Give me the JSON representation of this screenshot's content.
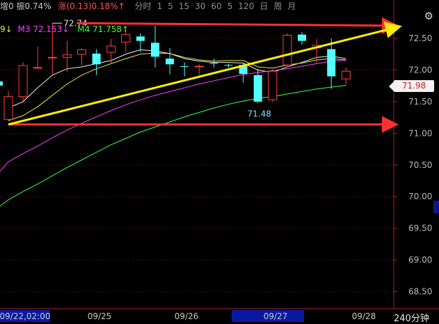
{
  "toolbar": {
    "amp_label": "增0",
    "amp_value": "振0.74%",
    "change_label": "涨",
    "change_value": "(0.13)",
    "change_pct": "0.18%↑",
    "menu_items": [
      "分时",
      "1",
      "5",
      "15",
      "30",
      "60",
      "5",
      "120",
      "日",
      "周",
      "月"
    ]
  },
  "legend": {
    "m2_tail": "9↓",
    "m3": "M3 72.153↓",
    "m4": "M4 71.758↑"
  },
  "current_price": "71.98",
  "timeframe": "240分钟",
  "colors": {
    "up": "#ff4040",
    "down": "#54ffff",
    "m1": "#f0f0f0",
    "m2": "#e8e840",
    "m3": "#ff40ff",
    "m4": "#40ff40",
    "axis": "#b02020",
    "trend_yellow": "#ffee00",
    "trend_red": "#ff3030"
  },
  "chart_data": {
    "type": "candlestick",
    "y_ticks": [
      "72.50",
      "72.00",
      "71.50",
      "71.00",
      "70.50",
      "70.00",
      "69.50",
      "69.00",
      "68.50"
    ],
    "ylim": [
      68.23,
      72.93
    ],
    "x_labels": [
      "09/22,02:00",
      "09/25",
      "09/26",
      "09/27",
      "09/28"
    ],
    "candles": [
      {
        "o": 71.22,
        "c": 71.58,
        "h": 71.67,
        "l": 71.19
      },
      {
        "o": 71.58,
        "c": 72.07,
        "h": 72.12,
        "l": 71.48
      },
      {
        "o": 72.04,
        "c": 72.04,
        "h": 72.37,
        "l": 72.02
      },
      {
        "o": 72.2,
        "c": 72.2,
        "h": 72.74,
        "l": 71.93
      },
      {
        "o": 72.2,
        "c": 72.24,
        "h": 72.46,
        "l": 71.97
      },
      {
        "o": 72.25,
        "c": 72.32,
        "h": 72.34,
        "l": 72.07
      },
      {
        "o": 72.26,
        "c": 72.09,
        "h": 72.33,
        "l": 71.92
      },
      {
        "o": 72.28,
        "c": 72.38,
        "h": 72.49,
        "l": 72.1
      },
      {
        "o": 72.44,
        "c": 72.56,
        "h": 72.65,
        "l": 72.28
      },
      {
        "o": 72.53,
        "c": 72.46,
        "h": 72.58,
        "l": 72.28
      },
      {
        "o": 72.43,
        "c": 72.21,
        "h": 72.7,
        "l": 72.04
      },
      {
        "o": 72.18,
        "c": 72.09,
        "h": 72.35,
        "l": 71.93
      },
      {
        "o": 72.06,
        "c": 72.05,
        "h": 72.12,
        "l": 71.9
      },
      {
        "o": 72.05,
        "c": 72.06,
        "h": 72.09,
        "l": 71.92
      },
      {
        "o": 72.11,
        "c": 72.1,
        "h": 72.18,
        "l": 72.04
      },
      {
        "o": 72.08,
        "c": 72.07,
        "h": 72.1,
        "l": 72.04
      },
      {
        "o": 72.08,
        "c": 71.94,
        "h": 72.1,
        "l": 71.8
      },
      {
        "o": 71.92,
        "c": 71.5,
        "h": 72.02,
        "l": 71.48
      },
      {
        "o": 71.53,
        "c": 71.98,
        "h": 72.01,
        "l": 71.5
      },
      {
        "o": 72.08,
        "c": 72.55,
        "h": 72.58,
        "l": 72.04
      },
      {
        "o": 72.56,
        "c": 72.46,
        "h": 72.6,
        "l": 72.4
      },
      {
        "o": 72.35,
        "c": 72.39,
        "h": 72.49,
        "l": 72.1
      },
      {
        "o": 72.33,
        "c": 71.9,
        "h": 72.5,
        "l": 71.7
      },
      {
        "o": 71.86,
        "c": 71.98,
        "h": 72.04,
        "l": 71.77
      }
    ],
    "series": [
      {
        "values": [
          71.4,
          71.5,
          71.72,
          71.92,
          72.02,
          72.05,
          72.1,
          72.15,
          72.25,
          72.32,
          72.3,
          72.26,
          72.18,
          72.14,
          72.12,
          72.12,
          72.11,
          72.0,
          71.96,
          72.05,
          72.12,
          72.2,
          72.22,
          72.18
        ]
      },
      {
        "values": [
          71.2,
          71.28,
          71.42,
          71.6,
          71.78,
          71.92,
          72.02,
          72.1,
          72.18,
          72.25,
          72.27,
          72.26,
          72.2,
          72.16,
          72.14,
          72.15,
          72.15,
          72.05,
          72.03,
          72.08,
          72.11,
          72.16,
          72.18,
          72.16
        ]
      },
      {
        "values": [
          70.55,
          70.68,
          70.8,
          70.93,
          71.05,
          71.16,
          71.26,
          71.36,
          71.45,
          71.53,
          71.6,
          71.66,
          71.72,
          71.78,
          71.83,
          71.88,
          71.93,
          71.96,
          71.99,
          72.02,
          72.06,
          72.1,
          72.14,
          72.153
        ]
      },
      {
        "values": [
          69.95,
          70.08,
          70.2,
          70.33,
          70.46,
          70.58,
          70.7,
          70.82,
          70.92,
          71.02,
          71.1,
          71.18,
          71.26,
          71.33,
          71.4,
          71.46,
          71.51,
          71.55,
          71.58,
          71.62,
          71.66,
          71.7,
          71.73,
          71.758
        ]
      }
    ],
    "annotations": [
      {
        "label": "72.74",
        "candle": 3,
        "value": 72.74
      },
      {
        "label": "71.48",
        "candle": 17,
        "value": 71.48
      }
    ]
  }
}
